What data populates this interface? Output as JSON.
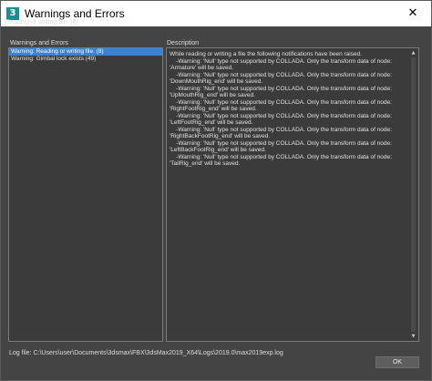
{
  "window": {
    "title": "Warnings and Errors",
    "app_icon": "3ds-max-icon",
    "close_symbol": "✕"
  },
  "header": {
    "line": "Reading or writing file. (8)"
  },
  "warnings_panel": {
    "title": "Warnings and Errors",
    "items": [
      {
        "label": "Warning: Reading or writing file. (8)",
        "selected": true
      },
      {
        "label": "Warning: Gimbal lock exists (49)",
        "selected": false
      }
    ]
  },
  "description_panel": {
    "title": "Description",
    "lines": [
      "While reading or writing a file the following notifications have been raised.",
      "    -Warning: 'Null' type not supported by COLLADA. Only the transform data of node:",
      "'Armature' will be saved.",
      "    -Warning: 'Null' type not supported by COLLADA. Only the transform data of node:",
      "'DownMouthRig_end' will be saved.",
      "    -Warning: 'Null' type not supported by COLLADA. Only the transform data of node:",
      "'UpMouthRig_end' will be saved.",
      "    -Warning: 'Null' type not supported by COLLADA. Only the transform data of node:",
      "'RightFootRig_end' will be saved.",
      "    -Warning: 'Null' type not supported by COLLADA. Only the transform data of node:",
      "'LeftFootRig_end' will be saved.",
      "    -Warning: 'Null' type not supported by COLLADA. Only the transform data of node:",
      "'RightBackFootRig_end' will be saved.",
      "    -Warning: 'Null' type not supported by COLLADA. Only the transform data of node:",
      "'LeftBackFootRig_end' will be saved.",
      "    -Warning: 'Null' type not supported by COLLADA. Only the transform data of node:",
      "'TailRig_end' will be saved."
    ]
  },
  "footer": {
    "log_file": "Log file: C:\\Users\\user\\Documents\\3dsmax\\FBX\\3dsMax2019_X64\\Logs\\2019.0\\max2019exp.log",
    "ok_label": "OK"
  },
  "colors": {
    "background": "#444444",
    "selection": "#3b82d4",
    "panel": "#3b3b3b"
  }
}
